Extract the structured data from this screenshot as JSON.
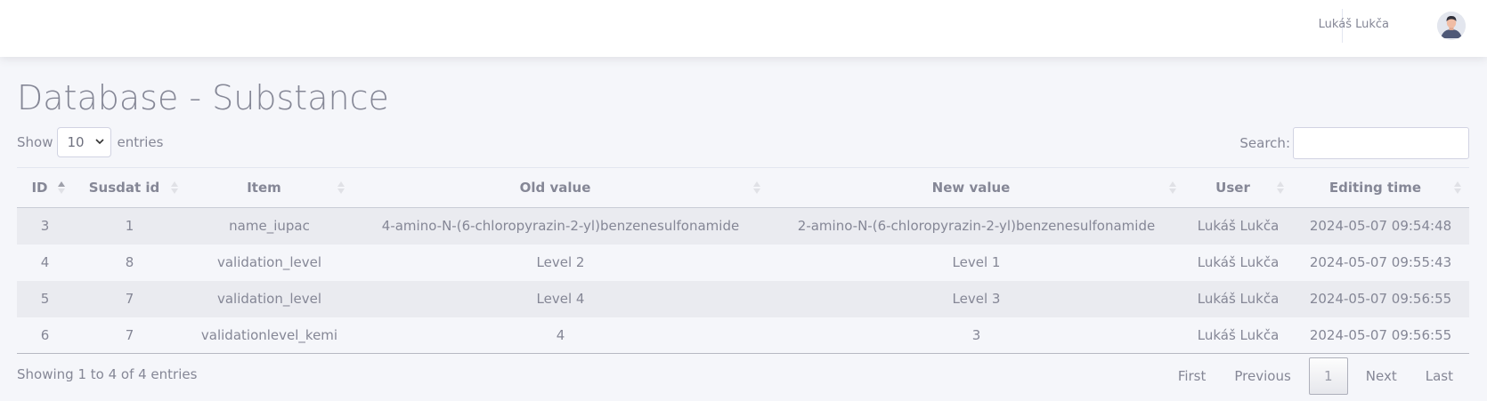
{
  "header": {
    "user_name": "Lukáš Lukča"
  },
  "page": {
    "title": "Database - Substance"
  },
  "length": {
    "show_label": "Show",
    "selected": "10",
    "entries_label": "entries"
  },
  "search": {
    "label": "Search:",
    "value": ""
  },
  "table": {
    "columns": [
      "ID",
      "Susdat id",
      "Item",
      "Old value",
      "New value",
      "User",
      "Editing time"
    ],
    "rows": [
      [
        "3",
        "1",
        "name_iupac",
        "4-amino-N-(6-chloropyrazin-2-yl)benzenesulfonamide",
        "2-amino-N-(6-chloropyrazin-2-yl)benzenesulfonamide",
        "Lukáš Lukča",
        "2024-05-07 09:54:48"
      ],
      [
        "4",
        "8",
        "validation_level",
        "Level 2",
        "Level 1",
        "Lukáš Lukča",
        "2024-05-07 09:55:43"
      ],
      [
        "5",
        "7",
        "validation_level",
        "Level 4",
        "Level 3",
        "Lukáš Lukča",
        "2024-05-07 09:56:55"
      ],
      [
        "6",
        "7",
        "validationlevel_kemi",
        "4",
        "3",
        "Lukáš Lukča",
        "2024-05-07 09:56:55"
      ]
    ]
  },
  "info": {
    "text": "Showing 1 to 4 of 4 entries"
  },
  "pagination": {
    "first": "First",
    "previous": "Previous",
    "current": "1",
    "next": "Next",
    "last": "Last"
  }
}
